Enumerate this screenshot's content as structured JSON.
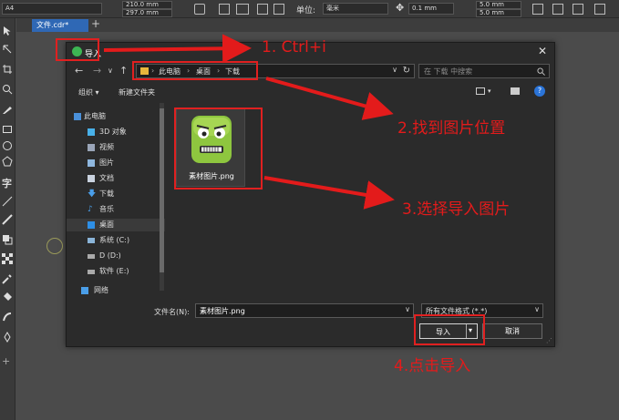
{
  "propbar": {
    "page_size": "A4",
    "width": "210.0 mm",
    "height": "297.0 mm",
    "unit_label": "单位:",
    "unit_value": "毫米",
    "nudge": "0.1 mm",
    "dup_x": "5.0 mm",
    "dup_y": "5.0 mm",
    "top_right_a": "5.0 mm",
    "top_right_b": "5.0 mm"
  },
  "tab": {
    "doc_name": "文件.cdr*",
    "add_label": "+"
  },
  "dialog": {
    "title": "导入",
    "close_label": "✕",
    "breadcrumbs": [
      "此电脑",
      "桌面",
      "下载"
    ],
    "search_placeholder": "在 下载 中搜索",
    "organize_label": "组织 ▾",
    "new_folder_label": "新建文件夹",
    "nav_items": [
      {
        "label": "此电脑",
        "icon": "pc-icon"
      },
      {
        "label": "3D 对象",
        "icon": "cube-icon"
      },
      {
        "label": "视频",
        "icon": "video-icon"
      },
      {
        "label": "图片",
        "icon": "picture-icon"
      },
      {
        "label": "文档",
        "icon": "document-icon"
      },
      {
        "label": "下载",
        "icon": "download-icon"
      },
      {
        "label": "音乐",
        "icon": "music-icon"
      },
      {
        "label": "桌面",
        "icon": "desktop-icon"
      },
      {
        "label": "系统 (C:)",
        "icon": "drive-icon"
      },
      {
        "label": "D (D:)",
        "icon": "drive-icon"
      },
      {
        "label": "软件 (E:)",
        "icon": "drive-icon"
      },
      {
        "label": "网络",
        "icon": "network-icon"
      }
    ],
    "file": {
      "name": "素材图片.png"
    },
    "filename_label": "文件名(N):",
    "filename_value": "素材图片.png",
    "filetype_value": "所有文件格式 (*.*)",
    "import_label": "导入",
    "cancel_label": "取消"
  },
  "annotations": {
    "step1": "1.  Ctrl+i",
    "step2": "2.找到图片位置",
    "step3": "3.选择导入图片",
    "step4": "4.点击导入",
    "color": "#e31b1b"
  }
}
